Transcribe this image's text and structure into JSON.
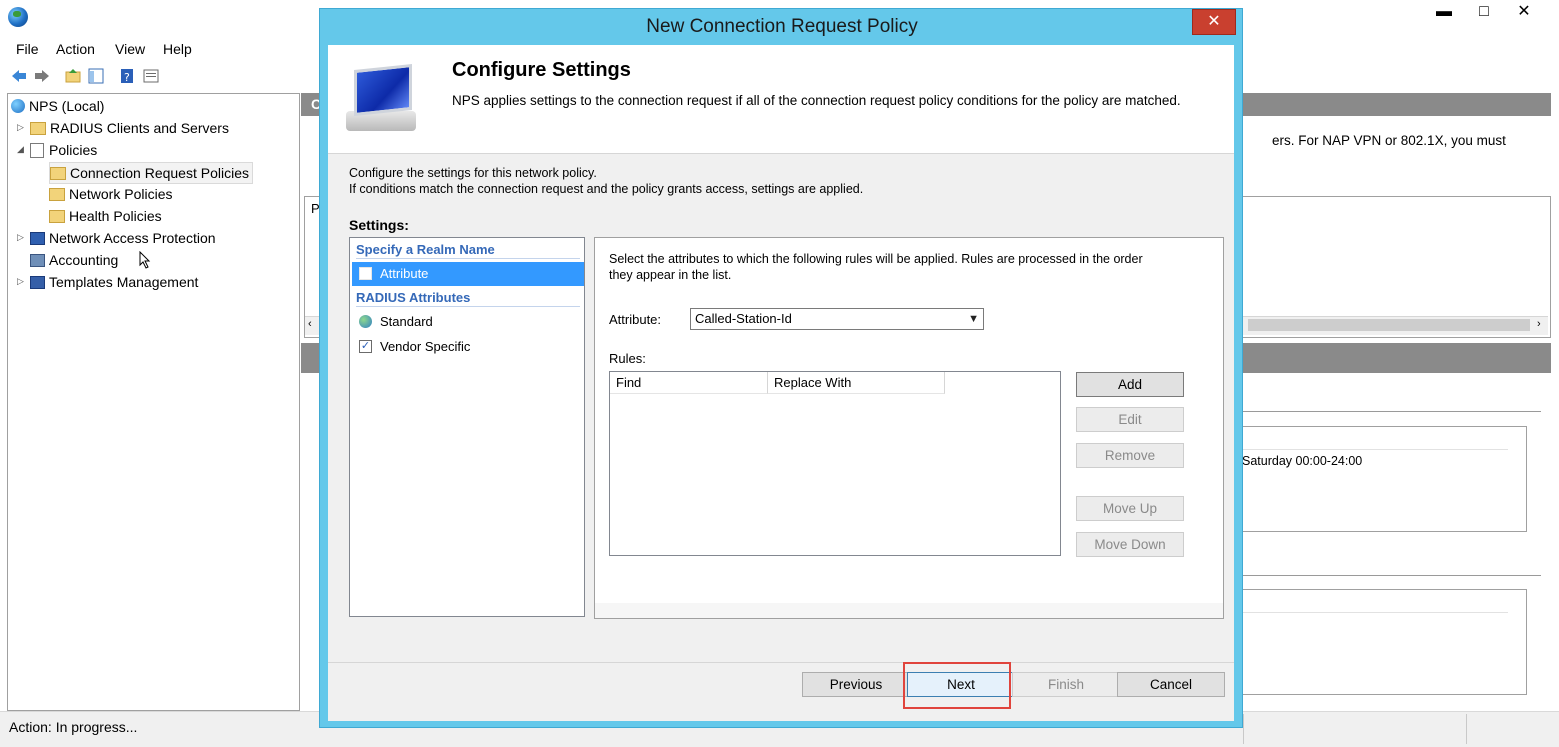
{
  "window": {
    "minimize_glyph": "▬",
    "maximize_glyph": "□",
    "close_glyph": "✕"
  },
  "menu": [
    "File",
    "Action",
    "View",
    "Help"
  ],
  "tree": {
    "root": "NPS (Local)",
    "items": [
      {
        "label": "RADIUS Clients and Servers"
      },
      {
        "label": "Policies"
      },
      {
        "label": "Connection Request Policies"
      },
      {
        "label": "Network Policies"
      },
      {
        "label": "Health Policies"
      },
      {
        "label": "Network Access Protection"
      },
      {
        "label": "Accounting"
      },
      {
        "label": "Templates Management"
      }
    ]
  },
  "background": {
    "pane_title_fragment": "C",
    "partial_text": "ers. For NAP VPN or 802.1X, you must",
    "column_fragment": "P",
    "schedule_text": "Saturday 00:00-24:00"
  },
  "status": {
    "text": "Action:  In progress..."
  },
  "dialog": {
    "title": "New Connection Request Policy",
    "close_glyph": "✕",
    "heading": "Configure Settings",
    "description": "NPS applies settings to the connection request if all of the connection request policy conditions  for the policy are matched.",
    "info_line1": "Configure the settings for this network policy.",
    "info_line2": "If conditions match the connection request and the policy grants access, settings are applied.",
    "settings_label": "Settings:",
    "groups": [
      {
        "header": "Specify a Realm Name",
        "items": [
          "Attribute"
        ]
      },
      {
        "header": "RADIUS Attributes",
        "items": [
          "Standard",
          "Vendor Specific"
        ]
      }
    ],
    "panel": {
      "instructions": "Select the attributes to which the following rules will be applied. Rules are processed in the order they appear in the list.",
      "attribute_label": "Attribute:",
      "attribute_value": "Called-Station-Id",
      "rules_label": "Rules:",
      "columns": [
        "Find",
        "Replace With"
      ],
      "buttons": {
        "add": "Add",
        "edit": "Edit",
        "remove": "Remove",
        "move_up": "Move Up",
        "move_down": "Move Down"
      }
    },
    "footer": {
      "previous": "Previous",
      "next": "Next",
      "finish": "Finish",
      "cancel": "Cancel"
    }
  },
  "colors": {
    "dialog_frame": "#64c8ea",
    "selection": "#3399ff",
    "highlight_box": "#e0443c",
    "group_header": "#3569b8"
  }
}
